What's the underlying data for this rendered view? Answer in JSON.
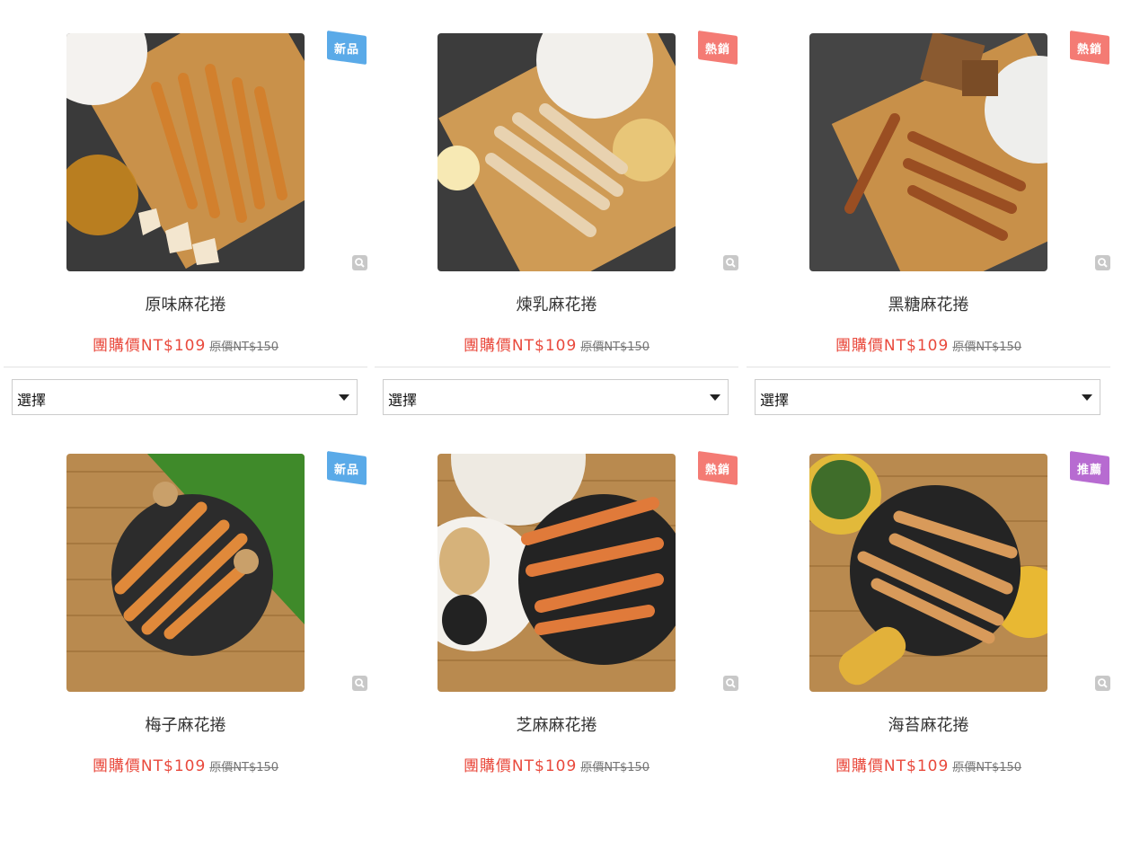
{
  "select_label": "選擇",
  "products": [
    {
      "name": "原味麻花捲",
      "group_price": "團購價NT$109",
      "original_price": "原價NT$150",
      "badge": "新品",
      "badge_color": "#5aaae8"
    },
    {
      "name": "煉乳麻花捲",
      "group_price": "團購價NT$109",
      "original_price": "原價NT$150",
      "badge": "熱銷",
      "badge_color": "#f47b74"
    },
    {
      "name": "黑糖麻花捲",
      "group_price": "團購價NT$109",
      "original_price": "原價NT$150",
      "badge": "熱銷",
      "badge_color": "#f47b74"
    },
    {
      "name": "梅子麻花捲",
      "group_price": "團購價NT$109",
      "original_price": "原價NT$150",
      "badge": "新品",
      "badge_color": "#5aaae8"
    },
    {
      "name": "芝麻麻花捲",
      "group_price": "團購價NT$109",
      "original_price": "原價NT$150",
      "badge": "熱銷",
      "badge_color": "#f47b74"
    },
    {
      "name": "海苔麻花捲",
      "group_price": "團購價NT$109",
      "original_price": "原價NT$150",
      "badge": "推薦",
      "badge_color": "#b76bd1"
    }
  ]
}
